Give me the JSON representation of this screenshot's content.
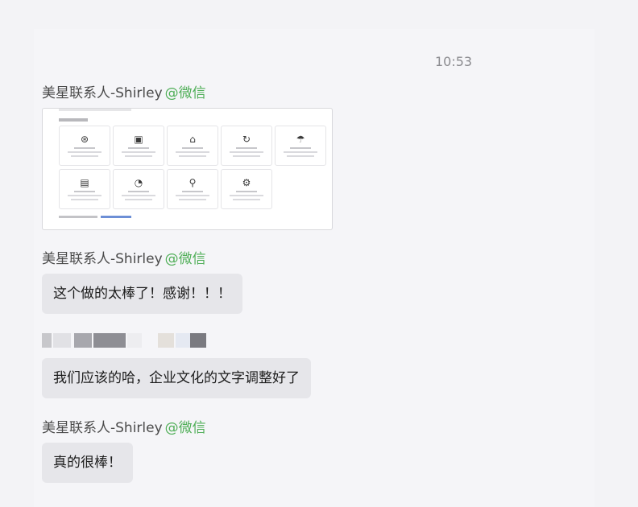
{
  "chat": {
    "timestamp": "10:53",
    "messages": [
      {
        "sender": "美星联系人-Shirley",
        "tag": "@微信",
        "type": "image"
      },
      {
        "sender": "美星联系人-Shirley",
        "tag": "@微信",
        "text": "这个做的太棒了！感谢！！！"
      },
      {
        "sender": "",
        "tag": "",
        "text": "我们应该的哈，企业文化的文字调整好了"
      },
      {
        "sender": "美星联系人-Shirley",
        "tag": "@微信",
        "text": "真的很棒！"
      }
    ]
  },
  "colors": {
    "background": "#f3f3f6",
    "bubble": "#e6e6ea",
    "wechat_tag": "#4fae57",
    "timestamp": "#8b8b8f"
  },
  "image_card": {
    "tile_icons": [
      "document-icon",
      "file-icon",
      "house-icon",
      "refresh-icon",
      "umbrella-icon",
      "save-icon",
      "clock-icon",
      "bike-icon",
      "cog-icon"
    ]
  }
}
